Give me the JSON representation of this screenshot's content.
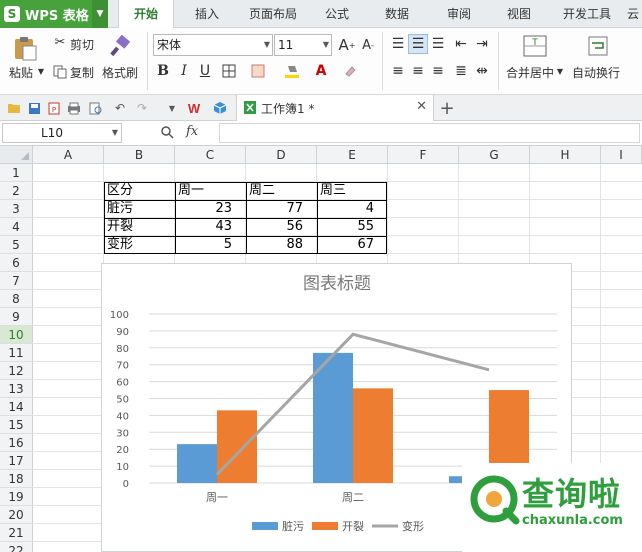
{
  "app": {
    "title": "WPS 表格",
    "logo": "S"
  },
  "menu_tabs": [
    "开始",
    "插入",
    "页面布局",
    "公式",
    "数据",
    "审阅",
    "视图",
    "开发工具",
    "云"
  ],
  "ribbon": {
    "paste": "粘贴",
    "cut": "剪切",
    "copy": "复制",
    "format_painter": "格式刷",
    "font_name": "宋体",
    "font_size": "11",
    "bold": "B",
    "italic": "I",
    "underline": "U",
    "merge_center": "合并居中",
    "wrap_text": "自动换行"
  },
  "doc_tab": {
    "name": "工作簿1 *"
  },
  "formula_bar": {
    "cell_ref": "L10",
    "fx": "fx"
  },
  "columns": [
    "A",
    "B",
    "C",
    "D",
    "E",
    "F",
    "G",
    "H",
    "I"
  ],
  "rows": [
    "1",
    "2",
    "3",
    "4",
    "5",
    "6",
    "7",
    "8",
    "9",
    "10",
    "11",
    "12",
    "13",
    "14",
    "15",
    "16",
    "17",
    "18",
    "19",
    "20",
    "21",
    "22"
  ],
  "selected_row": "10",
  "table": {
    "header": [
      "区分",
      "周一",
      "周二",
      "周三"
    ],
    "rows": [
      [
        "脏污",
        "23",
        "77",
        "4"
      ],
      [
        "开裂",
        "43",
        "56",
        "55"
      ],
      [
        "变形",
        "5",
        "88",
        "67"
      ]
    ]
  },
  "chart_data": {
    "type": "bar",
    "title": "图表标题",
    "categories": [
      "周一",
      "周二",
      "周三"
    ],
    "series": [
      {
        "name": "脏污",
        "type": "bar",
        "values": [
          23,
          77,
          4
        ],
        "color": "#5b9bd5"
      },
      {
        "name": "开裂",
        "type": "bar",
        "values": [
          43,
          56,
          55
        ],
        "color": "#ed7d31"
      },
      {
        "name": "变形",
        "type": "line",
        "values": [
          5,
          88,
          67
        ],
        "color": "#a5a5a5"
      }
    ],
    "ylim": [
      0,
      100
    ],
    "yticks": [
      "0",
      "10",
      "20",
      "30",
      "40",
      "50",
      "60",
      "70",
      "80",
      "90",
      "100"
    ],
    "grid": true,
    "legend": "bottom"
  },
  "watermark": {
    "text": "查询啦",
    "url": "chaxunla.com",
    "color": "#2f9e3c"
  }
}
